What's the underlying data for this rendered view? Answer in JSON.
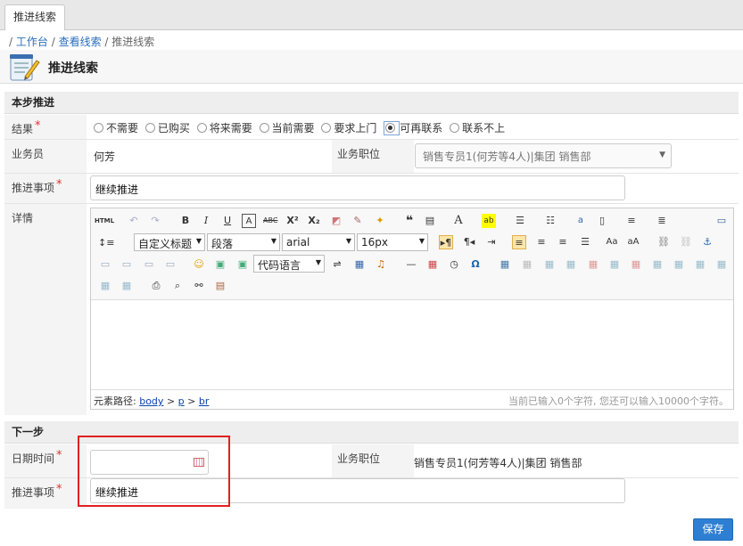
{
  "tab": {
    "label": "推进线索"
  },
  "breadcrumb": {
    "sep": "/ ",
    "item1": "工作台",
    "item2": "查看线索",
    "current": "推进线索"
  },
  "page": {
    "title": "推进线索"
  },
  "section1": {
    "title": "本步推进",
    "result_label": "结果",
    "result_options": [
      "不需要",
      "已购买",
      "将来需要",
      "当前需要",
      "要求上门",
      "可再联系",
      "联系不上"
    ],
    "result_selected": "可再联系",
    "salesperson_label": "业务员",
    "salesperson_value": "何芳",
    "position_label": "业务职位",
    "position_value": "销售专员1(何芳等4人)|集团 销售部",
    "item_label": "推进事项",
    "item_value": "继续推进",
    "detail_label": "详情"
  },
  "editor": {
    "html_label": "HTML",
    "heading_select": "自定义标题",
    "paragraph_select": "段落",
    "font_select": "arial",
    "size_select": "16px",
    "code_select": "代码语言",
    "path_label": "元素路径:",
    "path": [
      "body",
      "p",
      "br"
    ],
    "path_sep": ">",
    "count_text": "当前已输入0个字符, 您还可以输入10000个字符。"
  },
  "section2": {
    "title": "下一步",
    "date_label": "日期时间",
    "date_value": "",
    "position_label": "业务职位",
    "position_value": "销售专员1(何芳等4人)|集团 销售部",
    "item_label": "推进事项",
    "item_value": "继续推进"
  },
  "actions": {
    "save_label": "保存"
  },
  "colors": {
    "accent": "#2d7fd3",
    "required": "#e03030",
    "highlight_box": "#e02020"
  }
}
